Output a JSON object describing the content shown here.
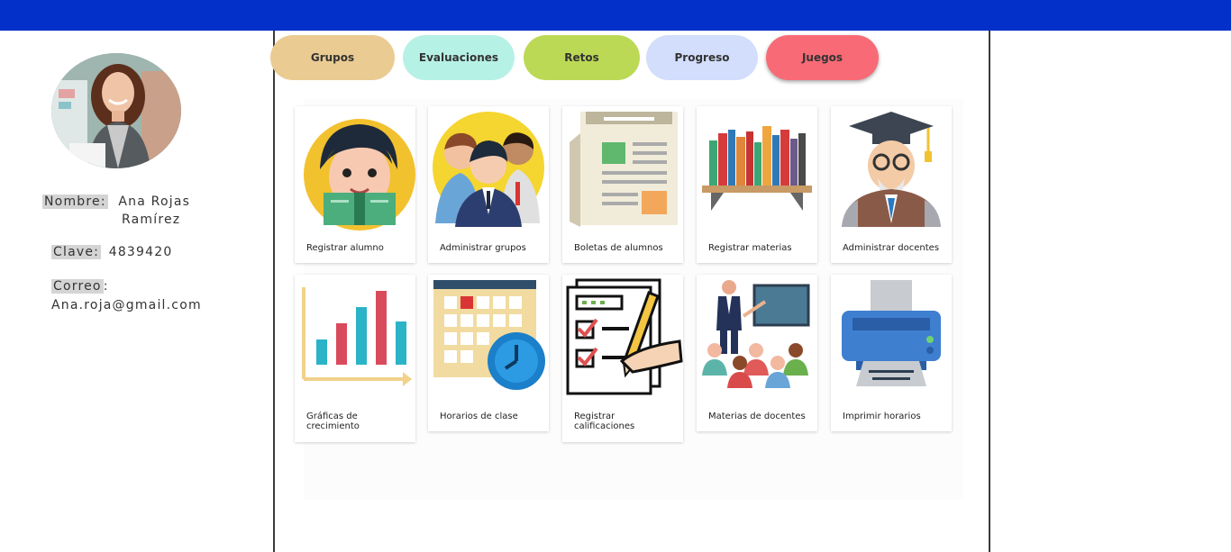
{
  "profile": {
    "nombre_label": "Nombre:",
    "nombre_line1": "Ana Rojas",
    "nombre_line2": "Ramírez",
    "clave_label": "Clave:",
    "clave_value": "4839420",
    "correo_label": "Correo",
    "correo_colon": ":",
    "correo_value": "Ana.roja@gmail.com"
  },
  "tabs": [
    "Grupos",
    "Evaluaciones",
    "Retos",
    "Progreso",
    "Juegos"
  ],
  "cards": [
    {
      "label": "Registrar alumno",
      "icon": "student-icon"
    },
    {
      "label": "Administrar grupos",
      "icon": "group-icon"
    },
    {
      "label": "Boletas de alumnos",
      "icon": "newspaper-icon"
    },
    {
      "label": "Registrar materias",
      "icon": "bookshelf-icon"
    },
    {
      "label": "Administrar docentes",
      "icon": "professor-icon"
    },
    {
      "label": "Gráficas de crecimiento",
      "icon": "bar-chart-icon"
    },
    {
      "label": "Horarios de clase",
      "icon": "calendar-clock-icon"
    },
    {
      "label": "Registrar calificaciones",
      "icon": "checklist-pencil-icon"
    },
    {
      "label": "Materias de docentes",
      "icon": "teacher-class-icon"
    },
    {
      "label": "Imprimir horarios",
      "icon": "printer-icon"
    }
  ],
  "colors": {
    "top_bar": "#0230c8",
    "tab_grupos": "#eacb92",
    "tab_evaluaciones": "#b6f1e6",
    "tab_retos": "#bcd955",
    "tab_progreso": "#d3ddfc",
    "tab_juegos": "#f86b76"
  }
}
